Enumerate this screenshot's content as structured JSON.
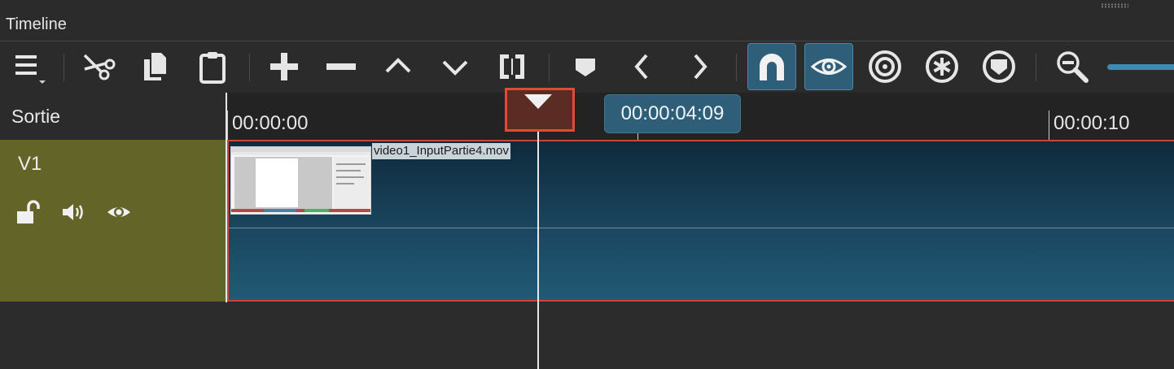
{
  "panel": {
    "title": "Timeline"
  },
  "toolbar": {
    "buttons": [
      {
        "name": "menu-icon",
        "active": false
      },
      {
        "name": "cut-icon",
        "active": false
      },
      {
        "name": "copy-icon",
        "active": false
      },
      {
        "name": "paste-icon",
        "active": false
      },
      {
        "name": "append-icon",
        "active": false
      },
      {
        "name": "remove-icon",
        "active": false
      },
      {
        "name": "lift-icon",
        "active": false
      },
      {
        "name": "overwrite-icon",
        "active": false
      },
      {
        "name": "split-icon",
        "active": false
      },
      {
        "name": "marker-icon",
        "active": false
      },
      {
        "name": "previous-marker-icon",
        "active": false
      },
      {
        "name": "next-marker-icon",
        "active": false
      },
      {
        "name": "snap-icon",
        "active": true
      },
      {
        "name": "scrub-icon",
        "active": true
      },
      {
        "name": "ripple-icon",
        "active": false
      },
      {
        "name": "ripple-all-icon",
        "active": false
      },
      {
        "name": "ripple-markers-icon",
        "active": false
      },
      {
        "name": "zoom-out-icon",
        "active": false
      }
    ],
    "accent_color": "#2f5f78"
  },
  "ruler": {
    "output_label": "Sortie",
    "ticks": [
      "00:00:00",
      "00:00:10"
    ],
    "playhead_time": "00:00:04:09"
  },
  "tracks": [
    {
      "name": "V1",
      "locked": false,
      "icons": [
        "unlock-icon",
        "audio-icon",
        "eye-icon"
      ],
      "clips": [
        {
          "label": "video1_InputPartie4.mov"
        }
      ]
    }
  ],
  "colors": {
    "track_header": "#636428",
    "selection_border": "#d0433a",
    "playhead_highlight": "#e34a35"
  }
}
